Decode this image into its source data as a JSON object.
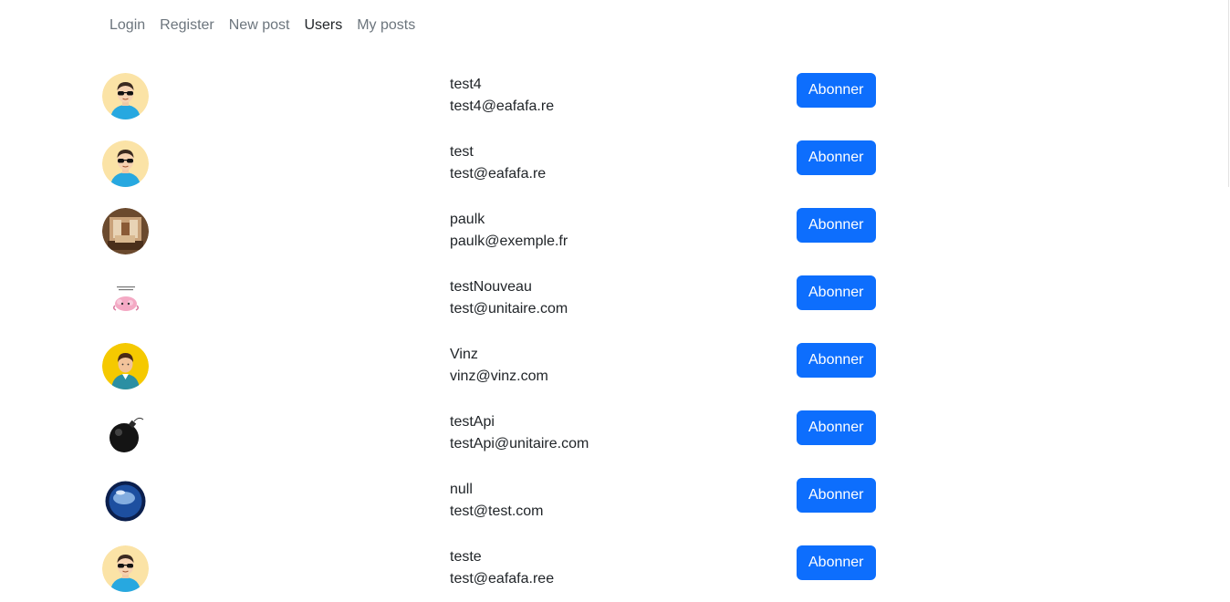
{
  "nav": {
    "items": [
      {
        "label": "Login",
        "active": false
      },
      {
        "label": "Register",
        "active": false
      },
      {
        "label": "New post",
        "active": false
      },
      {
        "label": "Users",
        "active": true
      },
      {
        "label": "My posts",
        "active": false
      }
    ]
  },
  "colors": {
    "primary": "#0d6efd",
    "nav_muted": "#6c757d",
    "text": "#212529"
  },
  "users": [
    {
      "username": "test4",
      "email": "test4@eafafa.re",
      "avatar": "sunglasses-man-avatar",
      "button": "Abonner"
    },
    {
      "username": "test",
      "email": "test@eafafa.re",
      "avatar": "sunglasses-man-avatar",
      "button": "Abonner"
    },
    {
      "username": "paulk",
      "email": "paulk@exemple.fr",
      "avatar": "room-photo-avatar",
      "button": "Abonner"
    },
    {
      "username": "testNouveau",
      "email": "test@unitaire.com",
      "avatar": "pink-cartoon-avatar",
      "button": "Abonner"
    },
    {
      "username": "Vinz",
      "email": "vinz@vinz.com",
      "avatar": "person-yellow-avatar",
      "button": "Abonner"
    },
    {
      "username": "testApi",
      "email": "testApi@unitaire.com",
      "avatar": "bomb-avatar",
      "button": "Abonner"
    },
    {
      "username": "null",
      "email": "test@test.com",
      "avatar": "blue-globe-avatar",
      "button": "Abonner"
    },
    {
      "username": "teste",
      "email": "test@eafafa.ree",
      "avatar": "sunglasses-man-avatar",
      "button": "Abonner"
    }
  ]
}
